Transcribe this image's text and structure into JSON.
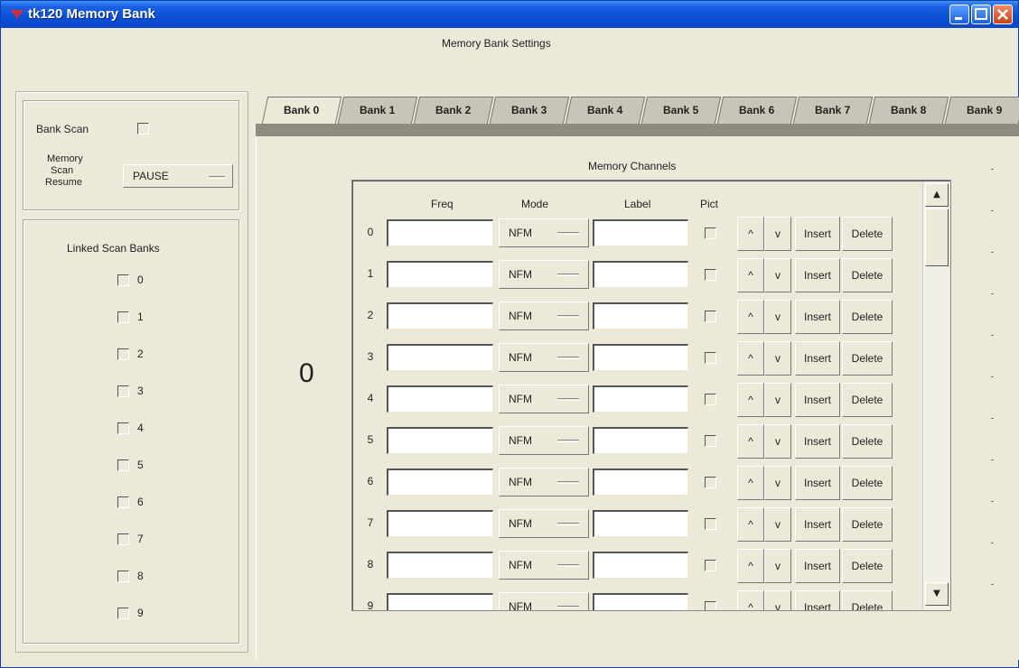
{
  "window": {
    "title": "tk120 Memory Bank"
  },
  "main": {
    "title": "Memory Bank Settings",
    "current_bank": "0"
  },
  "scan": {
    "bank_scan_label": "Bank Scan",
    "resume_label_1": "Memory",
    "resume_label_2": "Scan",
    "resume_label_3": "Resume",
    "resume_value": "PAUSE"
  },
  "linked": {
    "title": "Linked Scan Banks",
    "banks": [
      "0",
      "1",
      "2",
      "3",
      "4",
      "5",
      "6",
      "7",
      "8",
      "9"
    ]
  },
  "tabs": [
    "Bank 0",
    "Bank 1",
    "Bank 2",
    "Bank 3",
    "Bank 4",
    "Bank 5",
    "Bank 6",
    "Bank 7",
    "Bank 8",
    "Bank 9"
  ],
  "channels": {
    "title": "Memory Channels",
    "headers": {
      "freq": "Freq",
      "mode": "Mode",
      "label": "Label",
      "pict": "Pict"
    },
    "rows": [
      {
        "num": "0",
        "mode": "NFM"
      },
      {
        "num": "1",
        "mode": "NFM"
      },
      {
        "num": "2",
        "mode": "NFM"
      },
      {
        "num": "3",
        "mode": "NFM"
      },
      {
        "num": "4",
        "mode": "NFM"
      },
      {
        "num": "5",
        "mode": "NFM"
      },
      {
        "num": "6",
        "mode": "NFM"
      },
      {
        "num": "7",
        "mode": "NFM"
      },
      {
        "num": "8",
        "mode": "NFM"
      },
      {
        "num": "9",
        "mode": "NFM"
      }
    ],
    "buttons": {
      "up": "^",
      "down": "v",
      "insert": "Insert",
      "delete": "Delete"
    }
  },
  "icons": {
    "scroll_up": "scroll-up-icon",
    "scroll_down": "scroll-down-icon"
  }
}
